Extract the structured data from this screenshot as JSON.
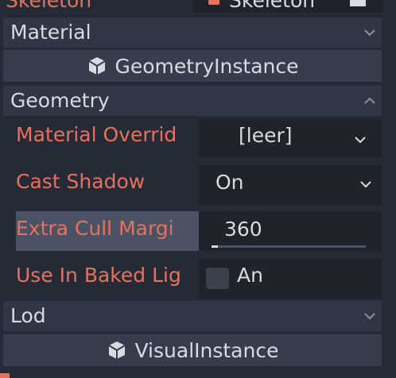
{
  "inspector": {
    "top_row": {
      "label": "Skeleton",
      "value": "Skeleton"
    },
    "sections": {
      "material": "Material",
      "geometry": "Geometry",
      "lod": "Lod"
    },
    "classes": {
      "geometry_instance": "GeometryInstance",
      "visual_instance": "VisualInstance"
    },
    "properties": {
      "material_override": {
        "label": "Material Overrid",
        "value": "[leer]"
      },
      "cast_shadow": {
        "label": "Cast Shadow",
        "value": "On"
      },
      "extra_cull_margin": {
        "label": "Extra Cull Margi",
        "value": "360"
      },
      "use_in_baked_light": {
        "label": "Use In Baked Lig",
        "value": "An",
        "checked": false
      }
    }
  },
  "colors": {
    "background": "#252b36",
    "property_label": "#e8705c",
    "text": "#d7dbe2",
    "field_bg": "#1e232c",
    "section_bg": "#2f3644",
    "class_bg": "#363e4d"
  },
  "icons": [
    "skeleton-icon",
    "document-icon",
    "chevron-down-icon",
    "chevron-up-icon",
    "cube-icon"
  ]
}
